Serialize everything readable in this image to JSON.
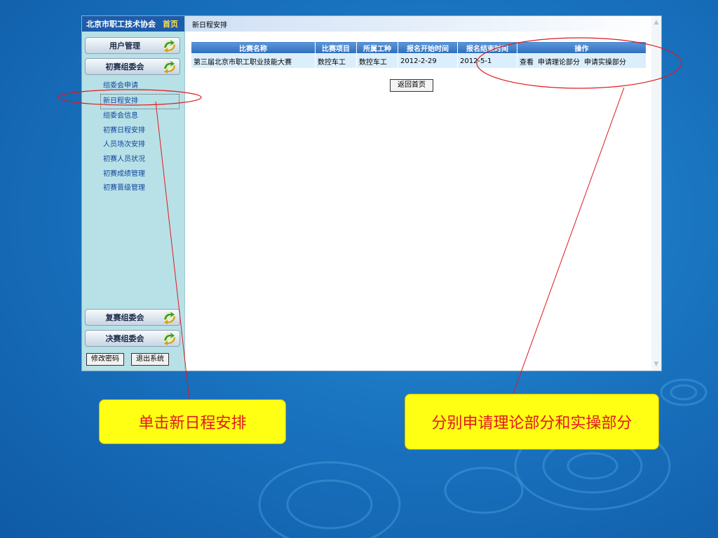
{
  "sidebar": {
    "org": "北京市职工技术协会",
    "home": "首页",
    "menus": {
      "user": "用户管理",
      "prelim": "初赛组委会",
      "rematch": "复赛组委会",
      "final": "决赛组委会"
    },
    "items": [
      "组委会申请",
      "新日程安排",
      "组委会信息",
      "初赛日程安排",
      "人员场次安排",
      "初赛人员状况",
      "初赛成绩管理",
      "初赛晋级管理"
    ],
    "change_password": "修改密码",
    "logout": "退出系统"
  },
  "page": {
    "title": "新日程安排",
    "back": "返回首页"
  },
  "table": {
    "headers": [
      "比赛名称",
      "比赛项目",
      "所属工种",
      "报名开始时间",
      "报名结束时间",
      "操作"
    ],
    "row": {
      "name": "第三届北京市职工职业技能大赛",
      "project": "数控车工",
      "trade": "数控车工",
      "start": "2012-2-29",
      "end": "2012-5-1",
      "ops": [
        "查看",
        "申请理论部分",
        "申请实操部分"
      ]
    }
  },
  "callouts": {
    "left": "单击新日程安排",
    "right": "分别申请理论部分和实操部分"
  },
  "colors": {
    "background": "#1a74c0",
    "header_blue": "#1d5cab",
    "callout_bg": "#ffff14",
    "callout_text": "#e0191f",
    "annotation": "#e0191f"
  }
}
